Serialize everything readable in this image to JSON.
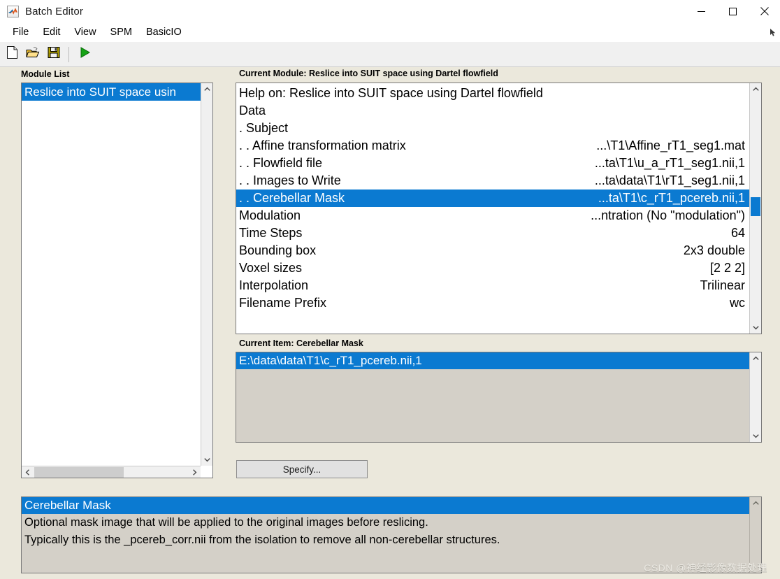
{
  "window": {
    "title": "Batch Editor",
    "icon": "matlab-icon",
    "controls": [
      {
        "name": "minimize-button",
        "glyph": "minimize-icon"
      },
      {
        "name": "maximize-button",
        "glyph": "maximize-icon"
      },
      {
        "name": "close-button",
        "glyph": "close-icon"
      }
    ]
  },
  "menubar": {
    "items": [
      {
        "label": "File"
      },
      {
        "label": "Edit"
      },
      {
        "label": "View"
      },
      {
        "label": "SPM"
      },
      {
        "label": "BasicIO"
      }
    ]
  },
  "toolbar": {
    "buttons": [
      {
        "name": "new-file-button",
        "icon": "new-file-icon"
      },
      {
        "name": "open-file-button",
        "icon": "open-folder-icon"
      },
      {
        "name": "save-file-button",
        "icon": "save-floppy-icon"
      },
      {
        "name": "run-button",
        "icon": "run-play-icon"
      }
    ]
  },
  "module_list": {
    "label": "Module List",
    "items": [
      {
        "label": "Reslice into SUIT space usin",
        "selected": true
      }
    ]
  },
  "current_module": {
    "label": "Current Module: Reslice into SUIT space using Dartel flowfield",
    "rows": [
      {
        "key": "Help on: Reslice into SUIT space using Dartel flowfield",
        "value": "",
        "selected": false
      },
      {
        "key": "Data",
        "value": "",
        "selected": false
      },
      {
        "key": ". Subject",
        "value": "",
        "selected": false
      },
      {
        "key": ". . Affine transformation matrix",
        "value": "...\\T1\\Affine_rT1_seg1.mat",
        "selected": false
      },
      {
        "key": ". . Flowfield file",
        "value": "...ta\\T1\\u_a_rT1_seg1.nii,1",
        "selected": false
      },
      {
        "key": ". . Images to Write",
        "value": "...ta\\data\\T1\\rT1_seg1.nii,1",
        "selected": false
      },
      {
        "key": ". . Cerebellar Mask",
        "value": "...ta\\T1\\c_rT1_pcereb.nii,1",
        "selected": true
      },
      {
        "key": "Modulation",
        "value": "...ntration (No \"modulation\")",
        "selected": false
      },
      {
        "key": "Time Steps",
        "value": "64",
        "selected": false
      },
      {
        "key": "Bounding box",
        "value": "2x3 double",
        "selected": false
      },
      {
        "key": "Voxel sizes",
        "value": "[2 2 2]",
        "selected": false
      },
      {
        "key": "Interpolation",
        "value": "Trilinear",
        "selected": false
      },
      {
        "key": "Filename Prefix",
        "value": "wc",
        "selected": false
      }
    ]
  },
  "current_item": {
    "label": "Current Item: Cerebellar Mask",
    "values": [
      {
        "text": "E:\\data\\data\\T1\\c_rT1_pcereb.nii,1",
        "selected": true
      }
    ],
    "specify_label": "Specify..."
  },
  "help_pane": {
    "title": "Cerebellar Mask",
    "lines": [
      "Optional mask image that will be applied to the original images before reslicing.",
      "Typically this is the _pcereb_corr.nii from the isolation to remove all non-cerebellar structures."
    ]
  },
  "watermark": "CSDN @神经影像数据处理",
  "colors": {
    "selection_blue": "#0b7ad1",
    "window_background": "#ebe8dc",
    "help_background": "#d4d0c8",
    "toolbar_background": "#f0f0f0"
  }
}
